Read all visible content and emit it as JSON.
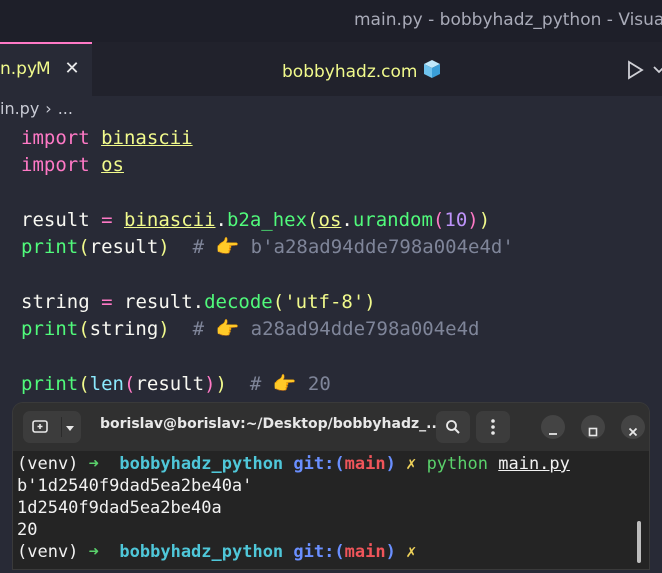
{
  "window": {
    "title": "main.py - bobbyhadz_python - Visual"
  },
  "tab": {
    "file_name": "n.py",
    "status_badge": "M",
    "close_glyph": "✕"
  },
  "brand": {
    "text": "bobbyhadz.com",
    "icon": "cube-icon"
  },
  "breadcrumb": {
    "file": "in.py",
    "separator": "›",
    "more": "..."
  },
  "code": {
    "line1": {
      "keyword": "import",
      "module": "binascii"
    },
    "line2": {
      "keyword": "import",
      "module": "os"
    },
    "line4": {
      "var": "result",
      "eq": "=",
      "mod1": "binascii",
      "dot1": ".",
      "func": "b2a_hex",
      "open1": "(",
      "mod2": "os",
      "dot2": ".",
      "func2": "urandom",
      "open2": "(",
      "num": "10",
      "close2": ")",
      "close1": ")"
    },
    "line5": {
      "func": "print",
      "open": "(",
      "arg": "result",
      "close": ")",
      "comment_hash": "#",
      "comment_value": "b'a28ad94dde798a004e4d'"
    },
    "line7": {
      "var": "string",
      "eq": "=",
      "obj": "result",
      "dot": ".",
      "method": "decode",
      "open": "(",
      "str": "'utf-8'",
      "close": ")"
    },
    "line8": {
      "func": "print",
      "open": "(",
      "arg": "string",
      "close": ")",
      "comment_hash": "#",
      "comment_value": "a28ad94dde798a004e4d"
    },
    "line10": {
      "func": "print",
      "open": "(",
      "func2": "len",
      "open2": "(",
      "arg": "result",
      "close2": ")",
      "close": ")",
      "comment_hash": "#",
      "comment_value": "20"
    },
    "pointing_hand": "👉"
  },
  "terminal": {
    "title": "borislav@borislav:~/Desktop/bobbyhadz_...",
    "lines": {
      "l1": {
        "venv": "(venv)",
        "arrow": "➜",
        "dir": "bobbyhadz_python",
        "git": "git:(",
        "branch": "main",
        "git_close": ")",
        "dirty": "✗",
        "cmd": "python",
        "arg": "main.py"
      },
      "l2": "b'1d2540f9dad5ea2be40a'",
      "l3": "1d2540f9dad5ea2be40a",
      "l4": "20",
      "l5": {
        "venv": "(venv)",
        "arrow": "➜",
        "dir": "bobbyhadz_python",
        "git": "git:(",
        "branch": "main",
        "git_close": ")",
        "dirty": "✗"
      }
    }
  },
  "colors": {
    "editor_bg": "#282a36",
    "keyword": "#ff79c6",
    "string": "#f1fa8c",
    "function": "#50fa7b",
    "number": "#bd93f9",
    "comment": "#7f8599",
    "terminal_bg": "#242424"
  }
}
